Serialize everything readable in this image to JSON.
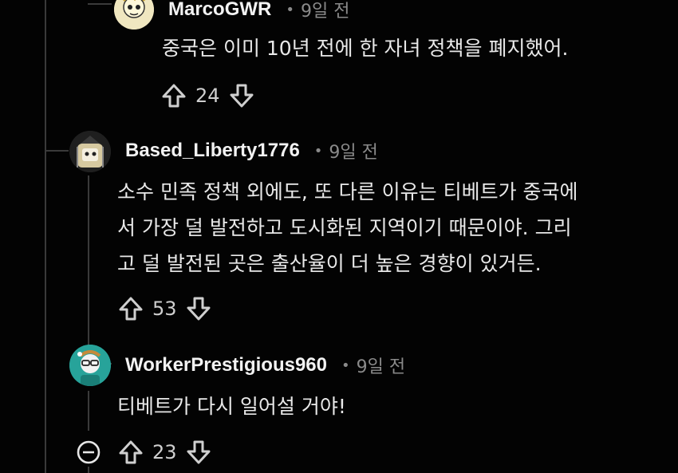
{
  "comments": [
    {
      "username": "MarcoGWR",
      "separator": "•",
      "time": "9일 전",
      "body": [
        "중국은 이미 10년 전에 한 자녀 정책을 폐지했어."
      ],
      "score": "24",
      "avatar_colors": {
        "bg": "#f0e7c0",
        "accent": "#222222"
      }
    },
    {
      "username": "Based_Liberty1776",
      "separator": "•",
      "time": "9일 전",
      "body": [
        "소수 민족 정책 외에도, 또 다른 이유는 티베트가 중국에",
        "서 가장 덜 발전하고 도시화된 지역이기 때문이야. 그리",
        "고 덜 발전된 곳은 출산율이 더 높은 경향이 있거든."
      ],
      "score": "53",
      "avatar_colors": {
        "bg": "#2a2a2a",
        "accent": "#d6c9a0"
      }
    },
    {
      "username": "WorkerPrestigious960",
      "separator": "•",
      "time": "9일 전",
      "body": [
        "티베트가 다시 일어설 거야!"
      ],
      "score": "23",
      "avatar_colors": {
        "bg": "#27a39a",
        "accent": "#f2f2f2"
      }
    }
  ],
  "icons": {
    "upvote": "arrow-up-outline",
    "downvote": "arrow-down-outline",
    "collapse": "minus-circle"
  },
  "colors": {
    "background": "#030303",
    "thread_line": "#3a3a3a",
    "muted": "#8a8a8a"
  }
}
